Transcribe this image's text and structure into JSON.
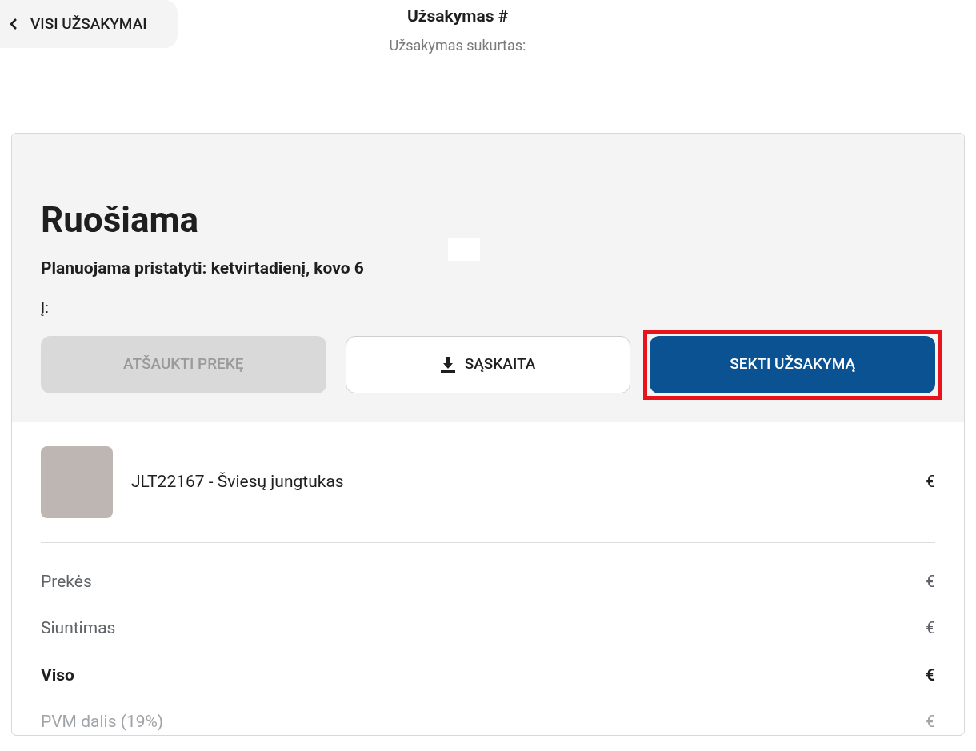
{
  "back_button": {
    "label": "VISI UŽSAKYMAI"
  },
  "header": {
    "title": "Užsakymas #",
    "subtitle": "Užsakymas sukurtas:"
  },
  "status": {
    "title": "Ruošiama",
    "delivery": "Planuojama pristatyti: ketvirtadienį, kovo 6",
    "address_label": "Į:"
  },
  "actions": [
    {
      "kind": "cancel",
      "label": "ATŠAUKTI PREKĘ",
      "disabled": true,
      "highlighted": false
    },
    {
      "kind": "download",
      "label": "SĄSKAITA",
      "disabled": false,
      "highlighted": false
    },
    {
      "kind": "primary",
      "label": "SEKTI UŽSAKYMĄ",
      "disabled": false,
      "highlighted": true
    }
  ],
  "items": [
    {
      "name": "JLT22167 - Šviesų jungtukas",
      "price": "€"
    }
  ],
  "summary": [
    {
      "kind": "normal",
      "label": "Prekės",
      "value": "€"
    },
    {
      "kind": "normal",
      "label": "Siuntimas",
      "value": "€"
    },
    {
      "kind": "total",
      "label": "Viso",
      "value": "€"
    },
    {
      "kind": "muted",
      "label": "PVM dalis (19%)",
      "value": "€"
    }
  ]
}
